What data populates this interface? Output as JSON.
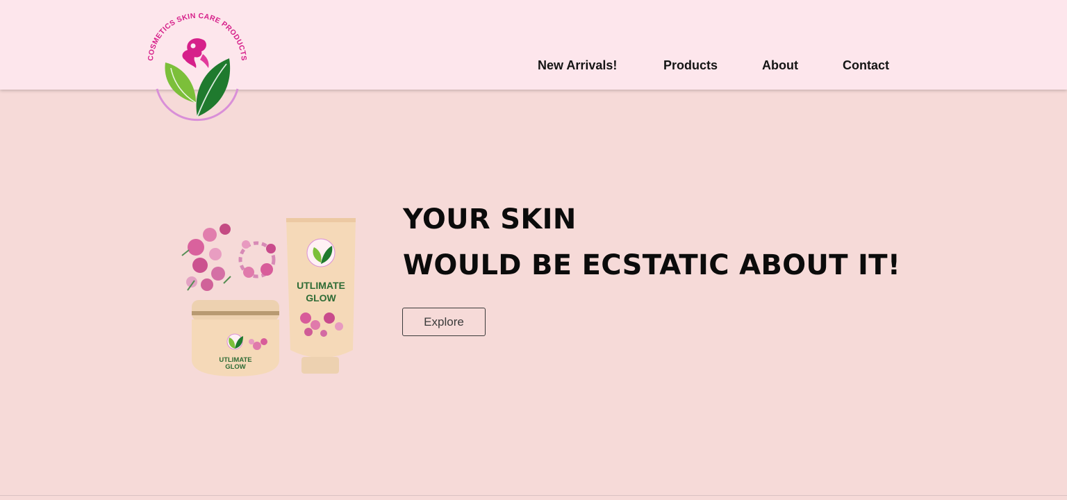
{
  "brand": {
    "logo_text": "COSMETICS SKIN CARE PRODUCTS",
    "colors": {
      "magenta": "#d6208a",
      "leaf_light": "#7cbf3a",
      "leaf_dark": "#1f7a2e",
      "ring": "#d98fd8"
    }
  },
  "nav": {
    "items": [
      {
        "label": "New Arrivals!"
      },
      {
        "label": "Products"
      },
      {
        "label": "About"
      },
      {
        "label": "Contact"
      }
    ]
  },
  "hero": {
    "headline_line1": "YOUR SKIN",
    "headline_line2": "WOULD BE ECSTATIC ABOUT IT!",
    "cta_label": "Explore",
    "product_name_line1": "UTLIMATE",
    "product_name_line2": "GLOW"
  },
  "colors": {
    "page_bg": "#f6dad8",
    "header_bg": "#fde6ec",
    "text": "#141414",
    "product_green": "#2e6b35",
    "packaging": "#f5d9b8"
  }
}
